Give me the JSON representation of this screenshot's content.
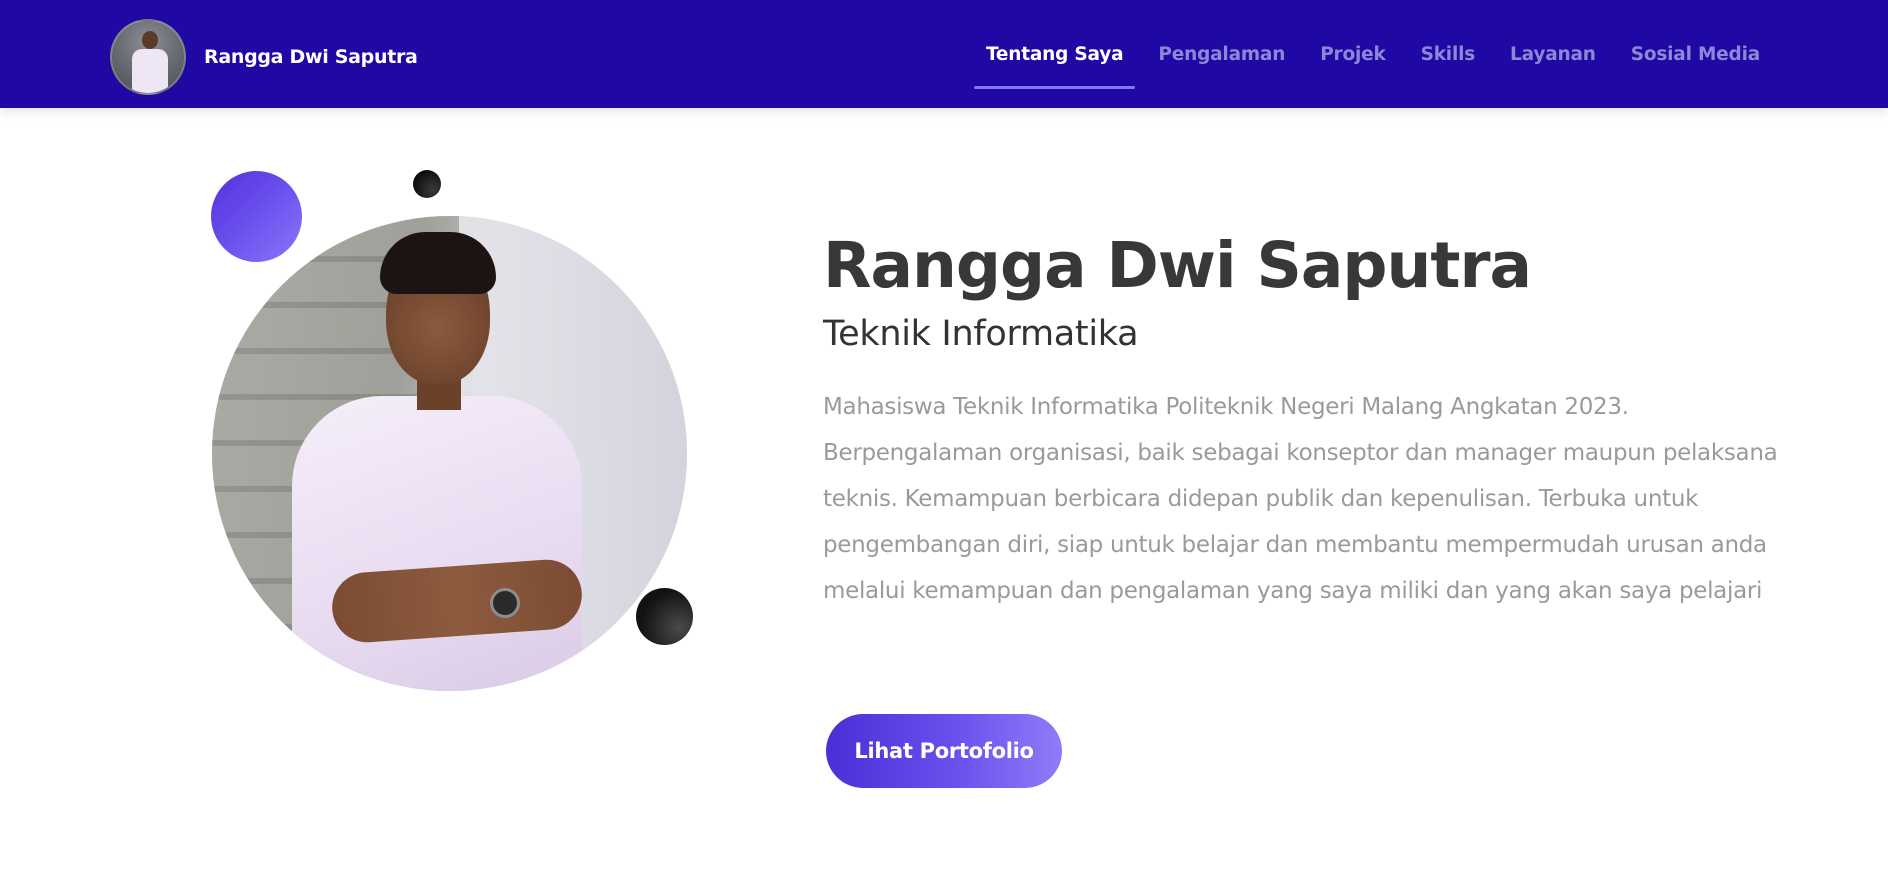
{
  "header": {
    "brand_name": "Rangga Dwi Saputra",
    "nav": [
      {
        "label": "Tentang Saya",
        "active": true
      },
      {
        "label": "Pengalaman",
        "active": false
      },
      {
        "label": "Projek",
        "active": false
      },
      {
        "label": "Skills",
        "active": false
      },
      {
        "label": "Layanan",
        "active": false
      },
      {
        "label": "Sosial Media",
        "active": false
      }
    ]
  },
  "hero": {
    "name": "Rangga Dwi Saputra",
    "role": "Teknik Informatika",
    "description": "Mahasiswa Teknik Informatika Politeknik Negeri Malang Angkatan 2023. Berpengalaman organisasi, baik sebagai konseptor dan manager maupun pelaksana teknis. Kemampuan berbicara didepan publik dan kepenulisan. Terbuka untuk pengembangan diri, siap untuk belajar dan membantu mempermudah urusan anda melalui kemampuan dan pengalaman yang saya miliki dan yang akan saya pelajari",
    "cta_label": "Lihat Portofolio"
  },
  "colors": {
    "header_bg": "#1f08a3",
    "nav_active": "#ffffff",
    "nav_inactive": "#8e86d6",
    "accent": "#6a50ee"
  }
}
